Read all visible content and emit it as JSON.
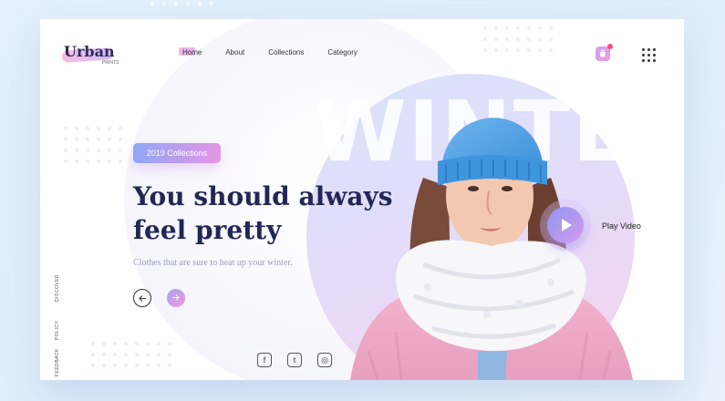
{
  "brand": {
    "name": "Urban",
    "subtitle": "PRINTS"
  },
  "nav": {
    "items": [
      "Home",
      "About",
      "Collections",
      "Category"
    ],
    "active": "Home"
  },
  "hero": {
    "badge": "2019 Collections",
    "heading_line1": "You should always",
    "heading_line2": "feel pretty",
    "tagline": "Clothes that are sure to heat up your winter.",
    "background_word": "WINTER"
  },
  "video": {
    "label": "Play Video"
  },
  "side_links": [
    "DISCOVER",
    "POLICY",
    "FEEDBACK"
  ],
  "socials": [
    {
      "icon": "facebook-icon",
      "glyph": "f"
    },
    {
      "icon": "twitter-icon",
      "glyph": "t"
    },
    {
      "icon": "instagram-icon",
      "glyph": "◎"
    }
  ],
  "colors": {
    "accent_pink": "#f095d8",
    "accent_purple": "#a9a6f6",
    "heading": "#222755",
    "cart_badge": "#ff4d6d"
  }
}
